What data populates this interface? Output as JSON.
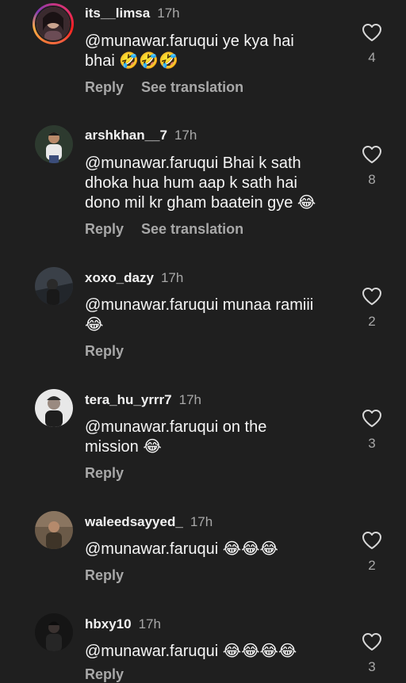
{
  "comments": [
    {
      "username": "its__limsa",
      "time": "17h",
      "text_line1": "@munawar.faruqui  ye kya hai",
      "text_line2": "bhai 🤣🤣🤣",
      "reply_label": "Reply",
      "translate_label": "See translation",
      "likes": "4"
    },
    {
      "username": "arshkhan__7",
      "time": "17h",
      "text_line1": "@munawar.faruqui Bhai k sath",
      "text_line2": "dhoka hua hum aap k sath hai",
      "text_line3": "dono mil kr gham baatein gye 😂",
      "reply_label": "Reply",
      "translate_label": "See translation",
      "likes": "8"
    },
    {
      "username": "xoxo_dazy",
      "time": "17h",
      "text_line1": "@munawar.faruqui munaa ramiii",
      "text_line2": "😂",
      "reply_label": "Reply",
      "likes": "2"
    },
    {
      "username": "tera_hu_yrrr7",
      "time": "17h",
      "text_line1": "@munawar.faruqui on the",
      "text_line2": "mission 😂",
      "reply_label": "Reply",
      "likes": "3"
    },
    {
      "username": "waleedsayyed_",
      "time": "17h",
      "text_line1": "@munawar.faruqui 😂😂😂",
      "reply_label": "Reply",
      "likes": "2"
    },
    {
      "username": "hbxy10",
      "time": "17h",
      "text_line1": "@munawar.faruqui 😂😂😂😂",
      "reply_label": "Reply",
      "likes": "3"
    }
  ],
  "colors": {
    "background": "#1f1f1f",
    "primary_text": "#f5f5f5",
    "secondary_text": "#a8a8a8"
  },
  "icons": {
    "like": "heart-outline-icon"
  }
}
